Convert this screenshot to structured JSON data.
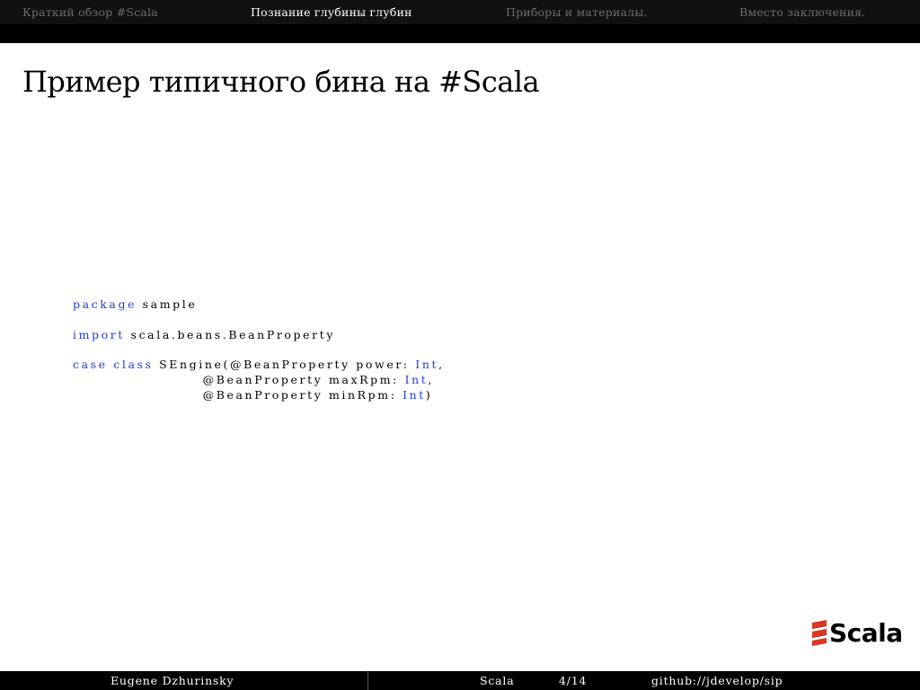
{
  "navbar": {
    "sections": [
      "Краткий обзор #Scala",
      "Познание глубины глубин",
      "Приборы и материалы.",
      "Вместо заключения."
    ],
    "active_index": 1
  },
  "frame": {
    "title": "Пример типичного бина на #Scala"
  },
  "code": {
    "line1": {
      "keyword": "package",
      "rest": " sample"
    },
    "line2": {
      "keyword": "import",
      "rest": " scala.beans.BeanProperty"
    },
    "line3": {
      "kw1": "case",
      "kw2": "class",
      "rest": " SEngine(@BeanProperty power: ",
      "type": "Int",
      "end": ","
    },
    "line4": {
      "rest": "@BeanProperty maxRpm: ",
      "type": "Int",
      "end": ","
    },
    "line5": {
      "rest": "@BeanProperty minRpm: ",
      "type": "Int",
      "end": ")"
    }
  },
  "logo": {
    "text": "Scala",
    "color": "#de3423"
  },
  "footer": {
    "author": "Eugene Dzhurinsky",
    "title": "Scala",
    "page": "4/14",
    "link": "github://jdevelop/sip"
  },
  "colors": {
    "keyword": "#1f3fd6",
    "nav_inactive": "#6d6d6d",
    "nav_active": "#ffffff"
  }
}
